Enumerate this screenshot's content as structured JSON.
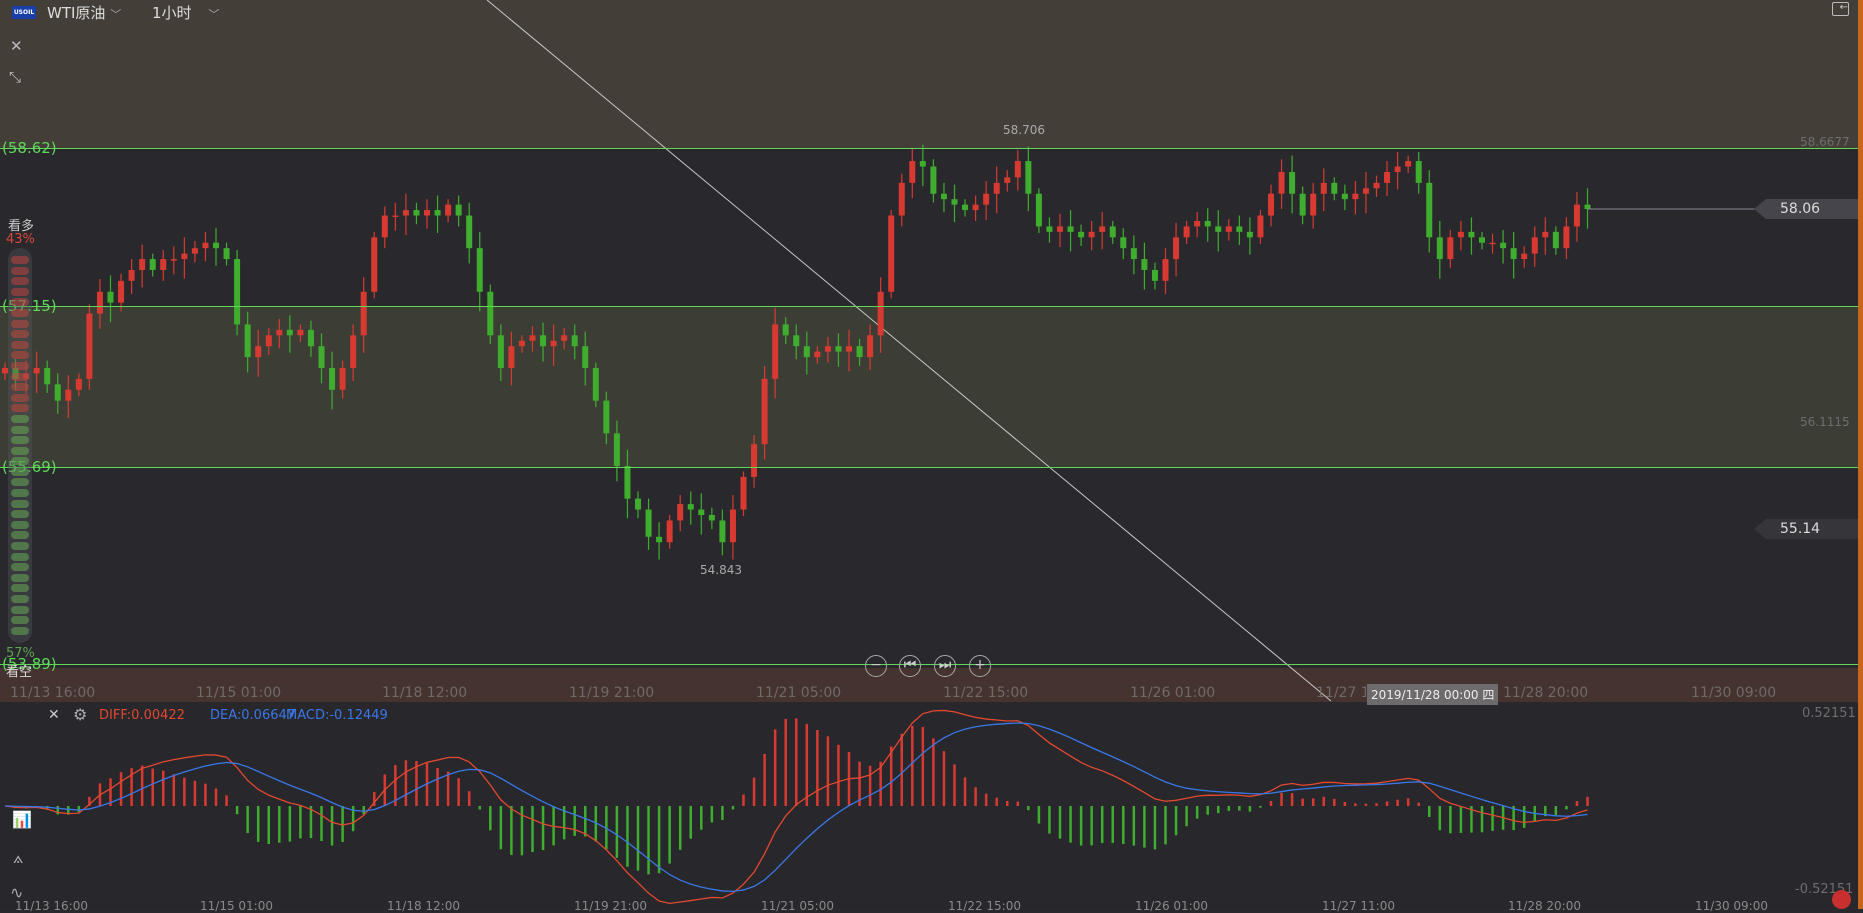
{
  "header": {
    "symbol_badge": "USOIL",
    "symbol": "WTI原油",
    "timeframe": "1小时"
  },
  "levels": [
    {
      "label": "(58.62)",
      "value": 58.62
    },
    {
      "label": "(57.15)",
      "value": 57.15
    },
    {
      "label": "(55.69)",
      "value": 55.69
    },
    {
      "label": "(53.89)",
      "value": 53.89
    }
  ],
  "zone_labels": {
    "upper": "58.6677",
    "middle": "56.1115"
  },
  "markers": {
    "high": "58.706",
    "low": "54.843"
  },
  "price_tags": {
    "current": "58.06",
    "cursor": "55.14"
  },
  "sentiment": {
    "bull_label": "看多",
    "bull_pct": "43%",
    "bear_label": "看空",
    "bear_pct": "57%",
    "bull_fraction": 0.43,
    "bull_color": "#d9473c",
    "bear_color": "#5da24e"
  },
  "x_ticks": [
    "11/13 16:00",
    "11/15 01:00",
    "11/18 12:00",
    "11/19 21:00",
    "11/21 05:00",
    "11/22 15:00",
    "11/26 01:00",
    "11/27 11:00",
    "11/28 20:00",
    "11/30 09:00"
  ],
  "cursor_time": "2019/11/28 00:00 四",
  "macd": {
    "diff": "DIFF:0.00422",
    "dea": "DEA:0.06647",
    "macd": "MACD:-0.12449",
    "max": "0.52151",
    "min": "-0.52151",
    "diff_color": "#e2492f",
    "dea_color": "#3a78e8"
  },
  "colors": {
    "up": "#d83a32",
    "down": "#3fae2f"
  },
  "chart_data": {
    "type": "candlestick",
    "price_ylim": [
      53.89,
      59.98
    ],
    "closes": [
      56.6,
      56.5,
      56.55,
      56.6,
      56.45,
      56.3,
      56.4,
      56.5,
      57.1,
      57.3,
      57.2,
      57.4,
      57.5,
      57.6,
      57.5,
      57.6,
      57.6,
      57.65,
      57.7,
      57.75,
      57.7,
      57.6,
      57.0,
      56.7,
      56.8,
      56.9,
      56.95,
      56.9,
      56.95,
      56.8,
      56.6,
      56.4,
      56.6,
      56.9,
      57.3,
      57.8,
      58.0,
      58.0,
      58.05,
      58.0,
      58.05,
      58.0,
      58.1,
      58.0,
      57.7,
      57.3,
      56.9,
      56.6,
      56.8,
      56.85,
      56.9,
      56.8,
      56.85,
      56.9,
      56.8,
      56.6,
      56.3,
      56.0,
      55.7,
      55.4,
      55.3,
      55.05,
      55.0,
      55.2,
      55.35,
      55.3,
      55.25,
      55.2,
      55.0,
      55.3,
      55.6,
      55.9,
      56.5,
      57.0,
      56.9,
      56.8,
      56.7,
      56.75,
      56.8,
      56.75,
      56.8,
      56.7,
      56.9,
      57.3,
      58.0,
      58.3,
      58.5,
      58.45,
      58.2,
      58.15,
      58.1,
      58.05,
      58.1,
      58.2,
      58.3,
      58.35,
      58.5,
      58.2,
      57.9,
      57.85,
      57.9,
      57.85,
      57.8,
      57.85,
      57.9,
      57.8,
      57.7,
      57.6,
      57.5,
      57.4,
      57.6,
      57.8,
      57.9,
      57.95,
      57.9,
      57.85,
      57.9,
      57.85,
      57.8,
      58.0,
      58.2,
      58.4,
      58.2,
      58.0,
      58.2,
      58.3,
      58.2,
      58.15,
      58.2,
      58.25,
      58.3,
      58.4,
      58.45,
      58.5,
      58.3,
      57.8,
      57.6,
      57.8,
      57.85,
      57.8,
      57.75,
      57.75,
      57.7,
      57.6,
      57.65,
      57.8,
      57.85,
      57.7,
      57.9,
      58.1,
      58.06
    ]
  }
}
